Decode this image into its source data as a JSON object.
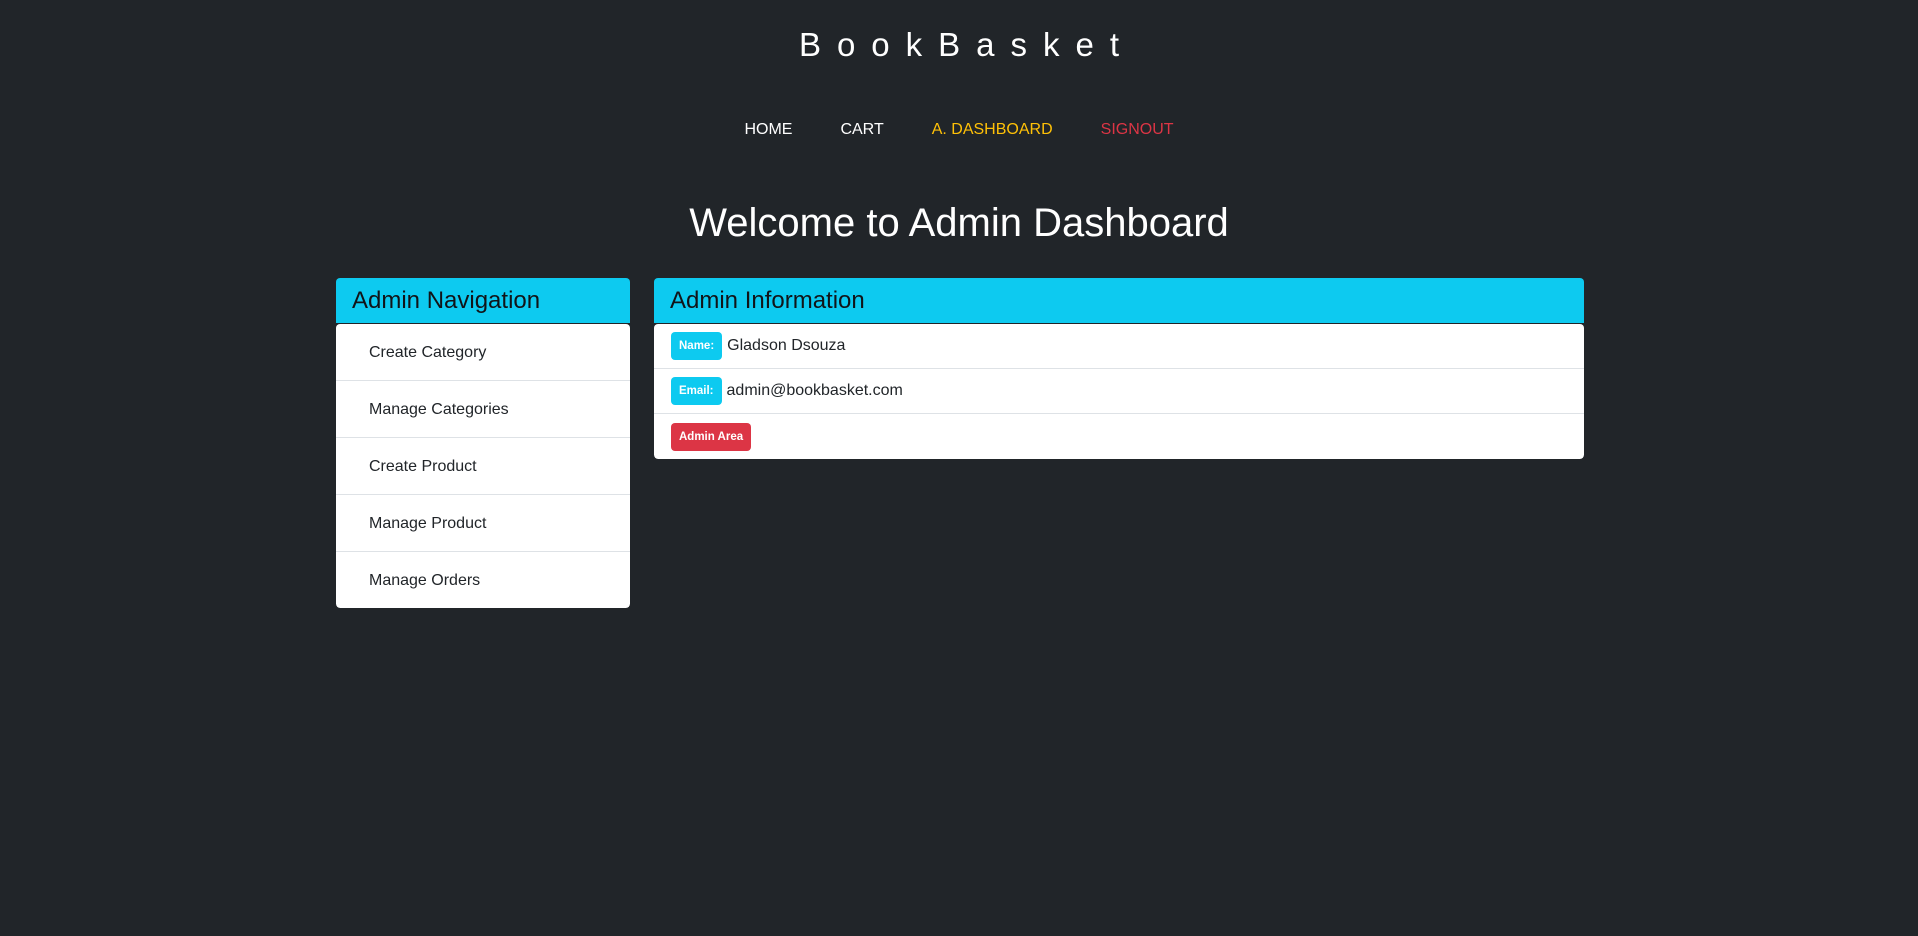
{
  "brand": "BookBasket",
  "topnav": {
    "items": [
      {
        "label": "HOME",
        "state": "default"
      },
      {
        "label": "CART",
        "state": "default"
      },
      {
        "label": "A. DASHBOARD",
        "state": "active"
      },
      {
        "label": "SIGNOUT",
        "state": "danger"
      }
    ]
  },
  "page_title": "Welcome to Admin Dashboard",
  "admin_nav": {
    "title": "Admin Navigation",
    "items": [
      {
        "label": "Create Category"
      },
      {
        "label": "Manage Categories"
      },
      {
        "label": "Create Product"
      },
      {
        "label": "Manage Product"
      },
      {
        "label": "Manage Orders"
      }
    ]
  },
  "admin_info": {
    "title": "Admin Information",
    "name_label": "Name:",
    "name_value": "Gladson Dsouza",
    "email_label": "Email:",
    "email_value": "admin@bookbasket.com",
    "role_badge": "Admin Area"
  },
  "colors": {
    "background": "#212529",
    "accent_info": "#0dcaf0",
    "active_link": "#ffc107",
    "danger": "#dc3545"
  }
}
